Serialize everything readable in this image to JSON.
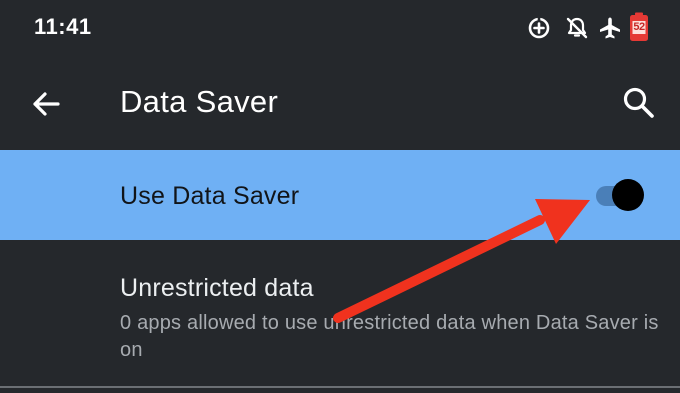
{
  "status_bar": {
    "time": "11:41",
    "battery_level": "52",
    "icons": [
      "data-saver-icon",
      "notifications-off-icon",
      "airplane-mode-icon",
      "battery-icon"
    ]
  },
  "app_bar": {
    "title": "Data Saver",
    "back_icon": "arrow-back-icon",
    "search_icon": "search-icon"
  },
  "settings": {
    "use_data_saver": {
      "label": "Use Data Saver",
      "enabled": true
    },
    "unrestricted_data": {
      "title": "Unrestricted data",
      "summary": "0 apps allowed to use unrestricted data when Data Saver is on"
    }
  },
  "colors": {
    "background": "#25282c",
    "highlight": "#6fb0f4",
    "annotation_arrow": "#f0321e",
    "battery_badge": "#e53935"
  }
}
